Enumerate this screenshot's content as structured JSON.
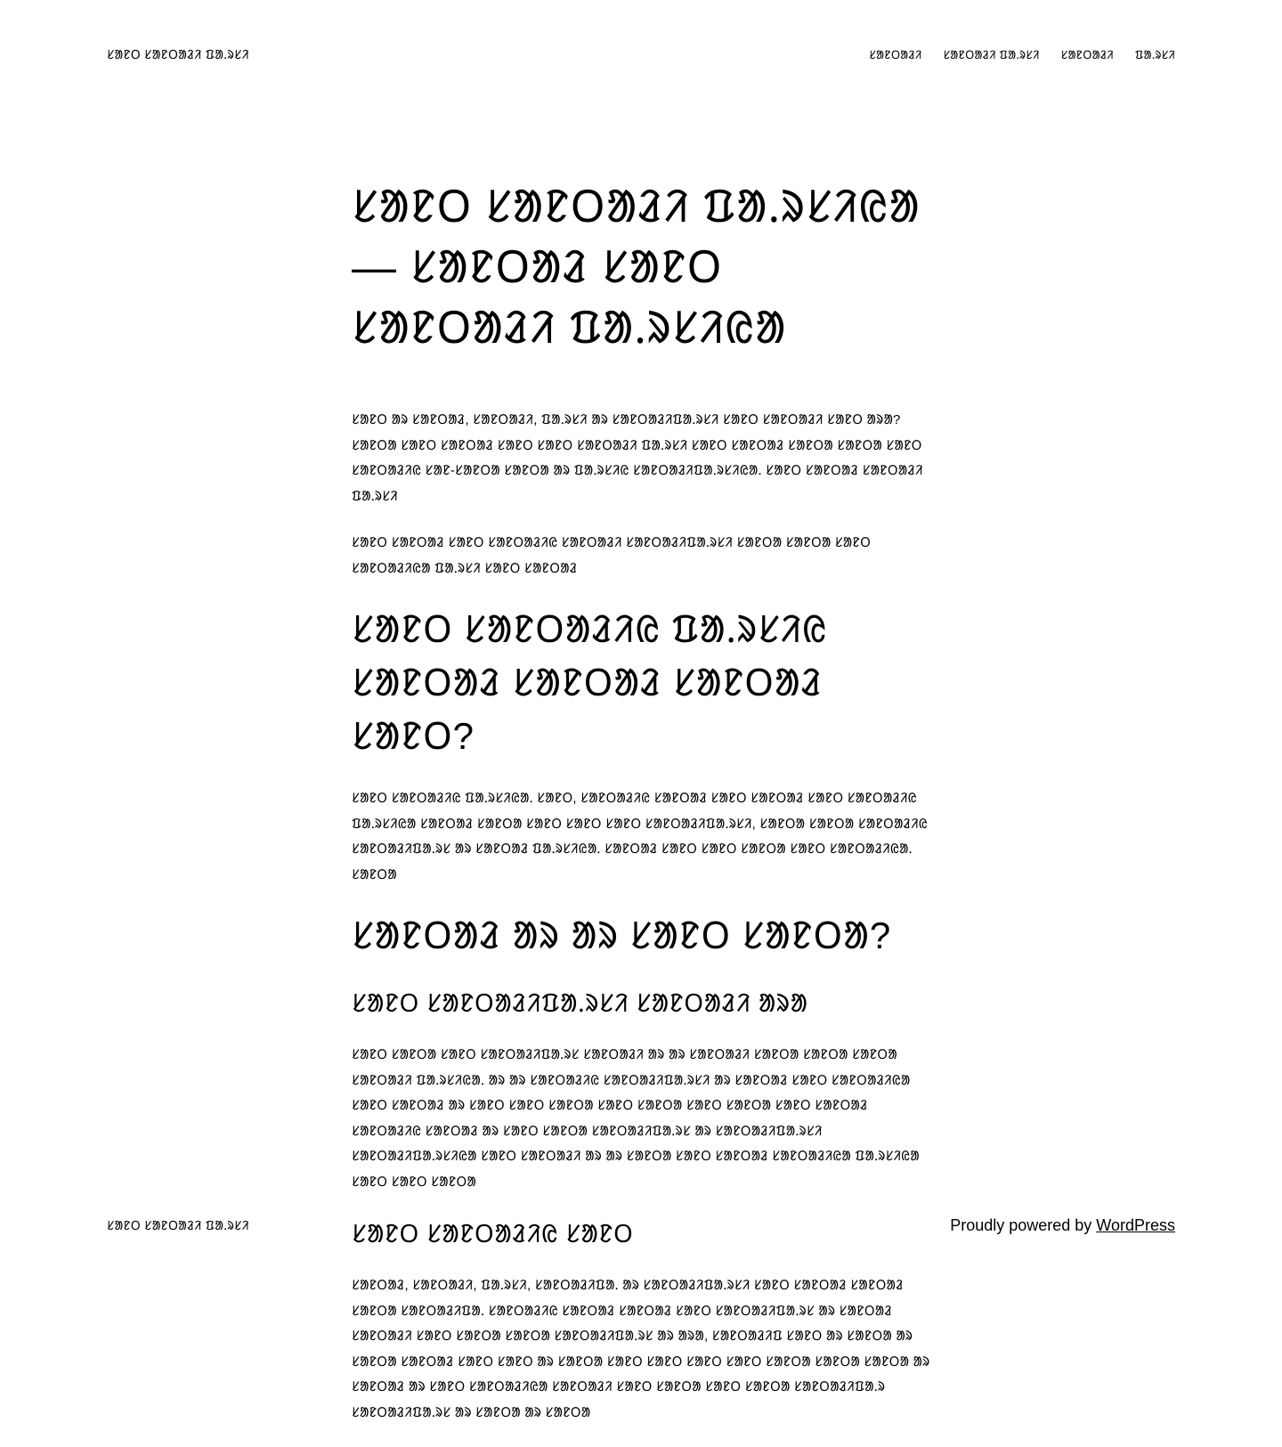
{
  "header": {
    "site_title": "ᱥᱟᱱᱛ ᱥᱟᱱᱛᱟᱲᱤ ᱯᱟᱹᱨᱥᱤ",
    "nav": [
      {
        "label": "ᱥᱟᱱᱛᱟᱲᱤ"
      },
      {
        "label": "ᱥᱟᱱᱛᱟᱲᱤ ᱯᱟᱹᱨᱥᱤ"
      },
      {
        "label": "ᱥᱟᱱᱛᱟᱲᱤ"
      },
      {
        "label": "ᱯᱟᱹᱨᱥᱤ"
      }
    ]
  },
  "article": {
    "title": "ᱥᱟᱱᱛ ᱥᱟᱱᱛᱟᱲᱤ ᱯᱟᱹᱨᱥᱤᱭᱟ — ᱥᱟᱱᱛᱟᱲ ᱥᱟᱱᱛ ᱥᱟᱱᱛᱟᱲᱤ ᱯᱟᱹᱨᱥᱤᱭᱟ",
    "intro_1": "ᱥᱟᱱᱛ ᱟᱨ ᱥᱟᱱᱛᱟᱲ, ᱥᱟᱱᱛᱟᱲᱤ, ᱯᱟᱹᱨᱥᱤ ᱟᱨ ᱥᱟᱱᱛᱟᱲᱤᱯᱟᱹᱨᱥᱤ ᱥᱟᱱᱛ ᱥᱟᱱᱛᱟᱲᱤ ᱥᱟᱱᱛ ᱟᱨᱟ? ᱥᱟᱱᱛᱟ ᱥᱟᱱᱛ ᱥᱟᱱᱛᱟᱲ ᱥᱟᱱᱛ ᱥᱟᱱᱛ ᱥᱟᱱᱛᱟᱲᱤ ᱯᱟᱹᱨᱥᱤ ᱥᱟᱱᱛ ᱥᱟᱱᱛᱟᱲ ᱥᱟᱱᱛᱟ ᱥᱟᱱᱛᱟ ᱥᱟᱱᱛ ᱥᱟᱱᱛᱟᱲᱤᱭ ᱥᱟᱱ-ᱥᱟᱱᱛᱟ ᱥᱟᱱᱛᱟ ᱟᱨ ᱯᱟᱹᱨᱥᱤᱭ ᱥᱟᱱᱛᱟᱲᱤᱯᱟᱹᱨᱥᱤᱭᱟᱹ ᱥᱟᱱᱛ ᱥᱟᱱᱛᱟᱲ ᱥᱟᱱᱛᱟᱲᱤ ᱯᱟᱹᱨᱥᱤ",
    "intro_2": "ᱥᱟᱱᱛ ᱥᱟᱱᱛᱟᱲ ᱥᱟᱱᱛ ᱥᱟᱱᱛᱟᱲᱤᱭ ᱥᱟᱱᱛᱟᱲᱤ ᱥᱟᱱᱛᱟᱲᱤᱯᱟᱹᱨᱥᱤ ᱥᱟᱱᱛᱟ ᱥᱟᱱᱛᱟ ᱥᱟᱱᱛ ᱥᱟᱱᱛᱟᱲᱤᱭᱟ ᱯᱟᱹᱨᱥᱤ ᱥᱟᱱᱛ ᱥᱟᱱᱛᱟᱲ",
    "h2_1": "ᱥᱟᱱᱛ ᱥᱟᱱᱛᱟᱲᱤᱭ ᱯᱟᱹᱨᱥᱤᱭ ᱥᱟᱱᱛᱟᱲ ᱥᱟᱱᱛᱟᱲ ᱥᱟᱱᱛᱟᱲ ᱥᱟᱱᱛ?",
    "p_1": "ᱥᱟᱱᱛ ᱥᱟᱱᱛᱟᱲᱤᱭ ᱯᱟᱹᱨᱥᱤᱭᱟᱹ ᱥᱟᱱᱛ, ᱥᱟᱱᱛᱟᱲᱤᱭ ᱥᱟᱱᱛᱟᱲ ᱥᱟᱱᱛ ᱥᱟᱱᱛᱟᱲ ᱥᱟᱱᱛ ᱥᱟᱱᱛᱟᱲᱤᱭ ᱯᱟᱹᱨᱥᱤᱭᱟ ᱥᱟᱱᱛᱟᱲ ᱥᱟᱱᱛᱟ ᱥᱟᱱᱛ ᱥᱟᱱᱛ ᱥᱟᱱᱛ ᱥᱟᱱᱛᱟᱲᱤᱯᱟᱹᱨᱥᱤ, ᱥᱟᱱᱛᱟ ᱥᱟᱱᱛᱟ ᱥᱟᱱᱛᱟᱲᱤᱭ ᱥᱟᱱᱛᱟᱲᱤᱯᱟᱹᱨᱥ ᱟᱨ ᱥᱟᱱᱛᱟᱲ ᱯᱟᱹᱨᱥᱤᱭᱟᱹ ᱥᱟᱱᱛᱟᱲ ᱥᱟᱱᱛ ᱥᱟᱱᱛ ᱥᱟᱱᱛᱟ ᱥᱟᱱᱛ ᱥᱟᱱᱛᱟᱲᱤᱭᱟᱹ ᱥᱟᱱᱛᱟ",
    "h2_2": "ᱥᱟᱱᱛᱟᱲ ᱟᱨ ᱟᱨ ᱥᱟᱱᱛ ᱥᱟᱱᱛᱟ?",
    "h3_1": "ᱥᱟᱱᱛ ᱥᱟᱱᱛᱟᱲᱤᱯᱟᱹᱨᱥᱤ ᱥᱟᱱᱛᱟᱲᱤ ᱟᱨᱟ",
    "p_2": "ᱥᱟᱱᱛ ᱥᱟᱱᱛᱟ ᱥᱟᱱᱛ ᱥᱟᱱᱛᱟᱲᱤᱯᱟᱹᱨᱥ ᱥᱟᱱᱛᱟᱲᱤ ᱟᱨ ᱟᱨ ᱥᱟᱱᱛᱟᱲᱤ ᱥᱟᱱᱛᱟ ᱥᱟᱱᱛᱟ ᱥᱟᱱᱛᱟ ᱥᱟᱱᱛᱟᱲᱤ ᱯᱟᱹᱨᱥᱤᱭᱟᱹ ᱟᱨ ᱟᱨ ᱥᱟᱱᱛᱟᱲᱤᱭ ᱥᱟᱱᱛᱟᱲᱤᱯᱟᱹᱨᱥᱤ ᱟᱨ ᱥᱟᱱᱛᱟᱲ ᱥᱟᱱᱛ ᱥᱟᱱᱛᱟᱲᱤᱭᱟ ᱥᱟᱱᱛ ᱥᱟᱱᱛᱟᱲ ᱟᱨ ᱥᱟᱱᱛ ᱥᱟᱱᱛ ᱥᱟᱱᱛᱟ ᱥᱟᱱᱛ ᱥᱟᱱᱛᱟ ᱥᱟᱱᱛ ᱥᱟᱱᱛᱟ ᱥᱟᱱᱛ ᱥᱟᱱᱛᱟᱲ ᱥᱟᱱᱛᱟᱲᱤᱭ ᱥᱟᱱᱛᱟᱲ ᱟᱨ ᱥᱟᱱᱛ ᱥᱟᱱᱛᱟ ᱥᱟᱱᱛᱟᱲᱤᱯᱟᱹᱨᱥ ᱟᱨ ᱥᱟᱱᱛᱟᱲᱤᱯᱟᱹᱨᱥᱤ ᱥᱟᱱᱛᱟᱲᱤᱯᱟᱹᱨᱥᱤᱭᱟ ᱥᱟᱱᱛ ᱥᱟᱱᱛᱟᱲᱤ ᱟᱨ ᱟᱨ ᱥᱟᱱᱛᱟ ᱥᱟᱱᱛ ᱥᱟᱱᱛᱟᱲ ᱥᱟᱱᱛᱟᱲᱤᱭᱟ ᱯᱟᱹᱨᱥᱤᱭᱟ ᱥᱟᱱᱛ ᱥᱟᱱᱛ ᱥᱟᱱᱛᱟ",
    "h3_2": "ᱥᱟᱱᱛ ᱥᱟᱱᱛᱟᱲᱤᱭ ᱥᱟᱱᱛ",
    "p_3": "ᱥᱟᱱᱛᱟᱲ, ᱥᱟᱱᱛᱟᱲᱤ, ᱯᱟᱹᱨᱥᱤ, ᱥᱟᱱᱛᱟᱲᱤᱯᱟᱹ ᱟᱨ ᱥᱟᱱᱛᱟᱲᱤᱯᱟᱹᱨᱥᱤ ᱥᱟᱱᱛ ᱥᱟᱱᱛᱟᱲ ᱥᱟᱱᱛᱟᱲ ᱥᱟᱱᱛᱟ ᱥᱟᱱᱛᱟᱲᱤᱯᱟᱹ ᱥᱟᱱᱛᱟᱲᱤᱭ ᱥᱟᱱᱛᱟᱲ ᱥᱟᱱᱛᱟᱲ ᱥᱟᱱᱛ ᱥᱟᱱᱛᱟᱲᱤᱯᱟᱹᱨᱥ ᱟᱨ ᱥᱟᱱᱛᱟᱲ ᱥᱟᱱᱛᱟᱲᱤ ᱥᱟᱱᱛ ᱥᱟᱱᱛᱟ ᱥᱟᱱᱛᱟ ᱥᱟᱱᱛᱟᱲᱤᱯᱟᱹᱨᱥ ᱟᱨ ᱟᱨᱟ, ᱥᱟᱱᱛᱟᱲᱤᱯ ᱥᱟᱱᱛ ᱟᱨ ᱥᱟᱱᱛᱟ ᱟᱨ ᱥᱟᱱᱛᱟ ᱥᱟᱱᱛᱟᱲ ᱥᱟᱱᱛ ᱥᱟᱱᱛ ᱟᱨ ᱥᱟᱱᱛᱟ ᱥᱟᱱᱛ ᱥᱟᱱᱛ ᱥᱟᱱᱛ ᱥᱟᱱᱛ ᱥᱟᱱᱛᱟ ᱥᱟᱱᱛᱟ ᱥᱟᱱᱛᱟ ᱟᱨ ᱥᱟᱱᱛᱟᱲ ᱟᱨ ᱥᱟᱱᱛ ᱥᱟᱱᱛᱟᱲᱤᱭᱟ ᱥᱟᱱᱛᱟᱲᱤ ᱥᱟᱱᱛ ᱥᱟᱱᱛᱟ ᱥᱟᱱᱛ ᱥᱟᱱᱛᱟ ᱥᱟᱱᱛᱟᱲᱤᱯᱟᱹᱨ ᱥᱟᱱᱛᱟᱲᱤᱯᱟᱹᱨᱥ ᱟᱨ ᱥᱟᱱᱛᱟ ᱟᱨ ᱥᱟᱱᱛᱟ"
  },
  "footer": {
    "site_title": "ᱥᱟᱱᱛ ᱥᱟᱱᱛᱟᱲᱤ ᱯᱟᱹᱨᱥᱤ",
    "powered_prefix": "Proudly powered by ",
    "powered_link": "WordPress"
  }
}
